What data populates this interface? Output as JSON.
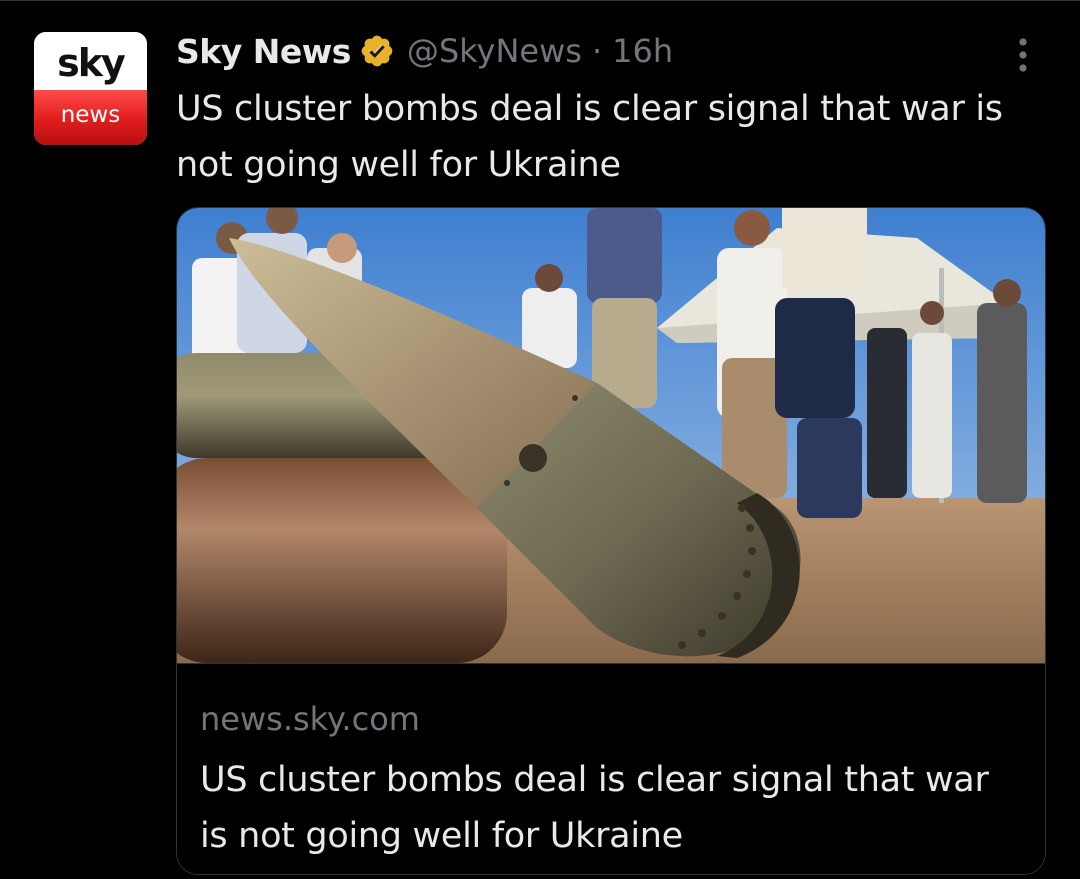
{
  "tweet": {
    "author": {
      "avatar": {
        "top_word": "sky",
        "bottom_word": "news",
        "accent": "#e01d1d"
      },
      "display_name": "Sky News",
      "verified_icon": "verified-gold-badge-icon",
      "verified_color": "#e8b22d",
      "handle": "@SkyNews",
      "separator": "·",
      "timestamp": "16h"
    },
    "more_icon": "vertical-ellipsis-icon",
    "text": "US cluster bombs deal is clear signal that war is not going well for Ukraine",
    "link_card": {
      "image": "photo of a cluster bomb casing lying on the ground in front of a crowd of people under a white tent canopy",
      "domain": "news.sky.com",
      "title": "US cluster bombs deal is clear signal that war is not going well for Ukraine"
    }
  },
  "colors": {
    "background": "#000000",
    "primary_text": "#e7e9ea",
    "secondary_text": "#71767b",
    "border": "#2f3336"
  }
}
